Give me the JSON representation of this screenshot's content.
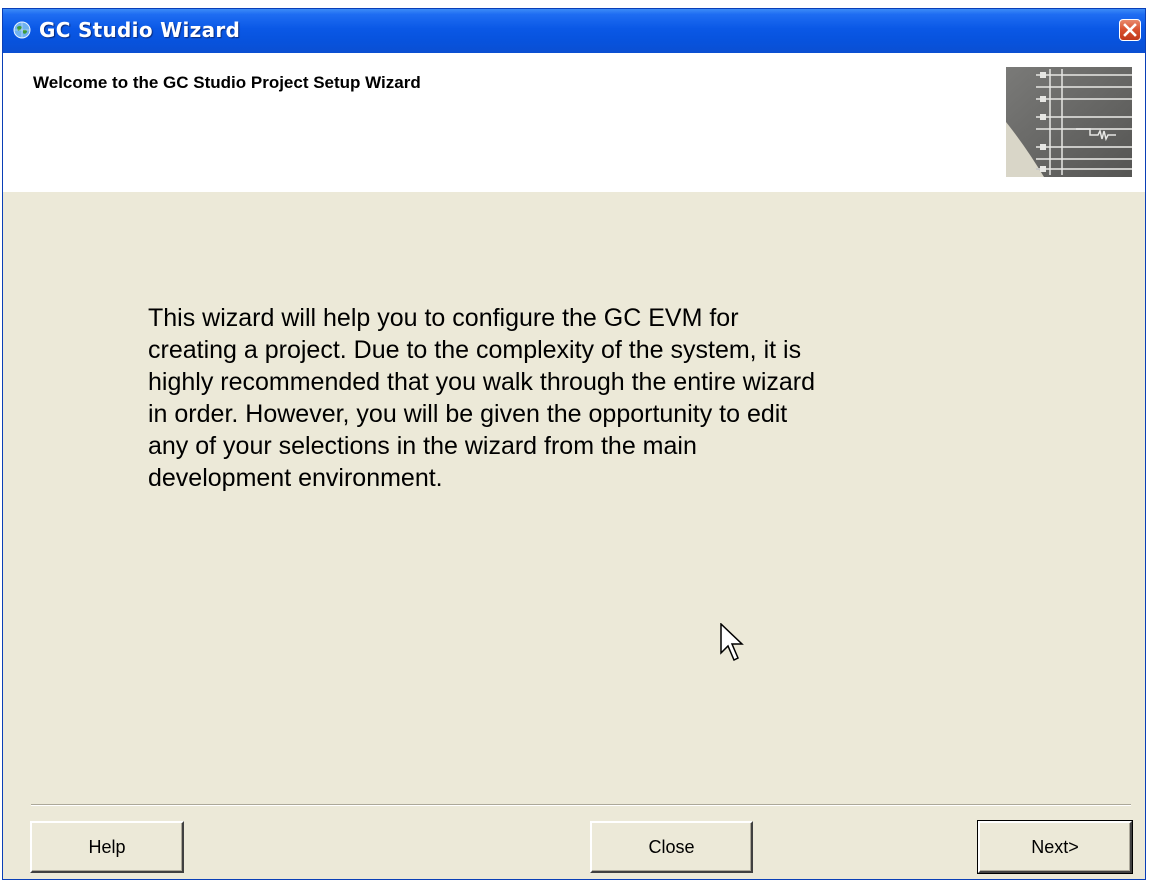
{
  "window": {
    "title": "GC Studio Wizard",
    "title_icon": "globe-icon",
    "close_icon": "close-icon",
    "colors": {
      "titlebar": "#0a58e6",
      "close_button": "#d8502f",
      "body": "#ece9d8",
      "header": "#ffffff"
    }
  },
  "header": {
    "title": "Welcome to the GC Studio Project Setup Wizard",
    "image": "wizard-graphic"
  },
  "content": {
    "body_text": "This wizard will help you to configure the GC EVM for\ncreating a project.  Due to the complexity of the system, it is\nhighly recommended that you walk through the entire wizard\nin order.  However, you will be given the opportunity to edit\nany of your selections in the wizard from the main\ndevelopment environment."
  },
  "buttons": {
    "help": "Help",
    "close": "Close",
    "next": "Next>"
  }
}
